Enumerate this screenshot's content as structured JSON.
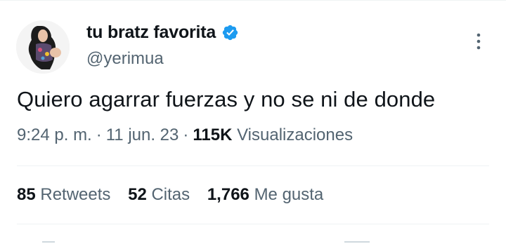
{
  "tweet": {
    "author": {
      "display_name": "tu bratz favorita",
      "handle": "@yerimua"
    },
    "text": "Quiero agarrar fuerzas y no se ni de donde",
    "time": "9:24 p. m.",
    "date": "11 jun. 23",
    "views_count": "115K",
    "views_label": "Visualizaciones",
    "stats": [
      {
        "count": "85",
        "label": "Retweets"
      },
      {
        "count": "52",
        "label": "Citas"
      },
      {
        "count": "1,766",
        "label": "Me gusta"
      }
    ]
  },
  "colors": {
    "verified": "#1d9bf0",
    "secondary_text": "#536471",
    "primary_text": "#0f1419"
  },
  "icons": [
    "verified-badge-icon",
    "more-options-icon"
  ]
}
